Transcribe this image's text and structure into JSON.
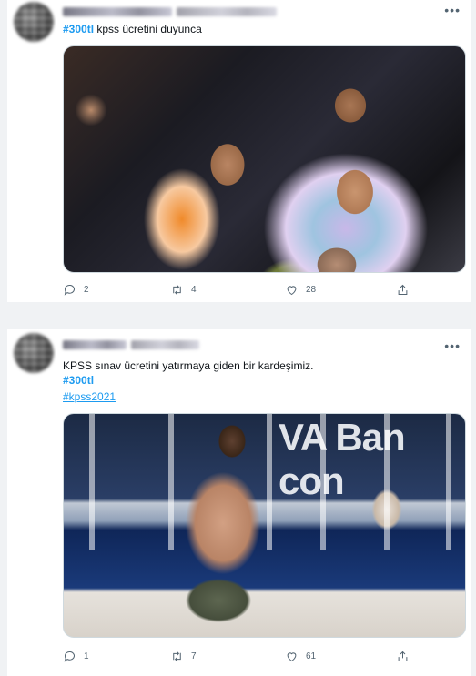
{
  "tweets": [
    {
      "text_tag": "#300tl",
      "text_rest": " kpss ücretini duyunca",
      "image_alt": "crowd photo",
      "stats": {
        "replies": "2",
        "retweets": "4",
        "likes": "28"
      }
    },
    {
      "text_line1": "KPSS sınav ücretini yatırmaya giden bir kardeşimiz.",
      "text_tag": "#300tl",
      "text_link": "#kpss2021",
      "bank_sign": "VA Ban con",
      "stats": {
        "replies": "1",
        "retweets": "7",
        "likes": "61"
      }
    }
  ],
  "icons": {
    "more": "more-icon",
    "reply": "reply-icon",
    "retweet": "retweet-icon",
    "like": "heart-icon",
    "share": "share-icon"
  },
  "colors": {
    "accent": "#1d9bf0",
    "muted": "#536471",
    "background": "#f0f2f4"
  }
}
